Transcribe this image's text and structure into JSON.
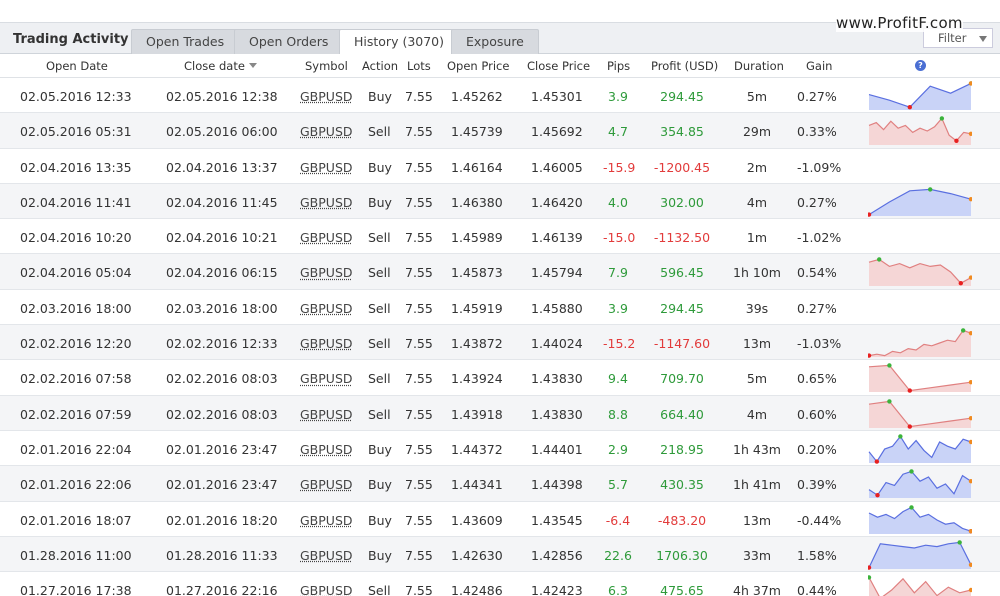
{
  "brand": "www.ProfitF.com",
  "title": "Trading Activity",
  "tabs": [
    {
      "label": "Open Trades",
      "active": false
    },
    {
      "label": "Open Orders",
      "active": false
    },
    {
      "label": "History (3070)",
      "active": true
    },
    {
      "label": "Exposure",
      "active": false
    }
  ],
  "filter": {
    "label": "Filter"
  },
  "columns": [
    "Open Date",
    "Close date",
    "Symbol",
    "Action",
    "Lots",
    "Open Price",
    "Close Price",
    "Pips",
    "Profit (USD)",
    "Duration",
    "Gain"
  ],
  "colors": {
    "positive": "#2e9a3a",
    "negative": "#e23b3b",
    "sparkBuyLine": "#5a6fe0",
    "sparkBuyFill": "#c9d3f7",
    "sparkSellLine": "#e08080",
    "sparkSellFill": "#f5d6d6"
  },
  "rows": [
    {
      "open": "02.05.2016 12:33",
      "close": "02.05.2016 12:38",
      "symbol": "GBPUSD",
      "action": "Buy",
      "lots": "7.55",
      "openPrice": "1.45262",
      "closePrice": "1.45301",
      "pips": "3.9",
      "profit": "294.45",
      "duration": "5m",
      "gain": "0.27%",
      "spark": [
        0.55,
        0.35,
        0.1,
        0.85,
        0.6,
        0.95
      ]
    },
    {
      "open": "02.05.2016 05:31",
      "close": "02.05.2016 06:00",
      "symbol": "GBPUSD",
      "action": "Sell",
      "lots": "7.55",
      "openPrice": "1.45739",
      "closePrice": "1.45692",
      "pips": "4.7",
      "profit": "354.85",
      "duration": "29m",
      "gain": "0.33%",
      "spark": [
        0.7,
        0.8,
        0.55,
        0.85,
        0.6,
        0.7,
        0.45,
        0.6,
        0.5,
        0.65,
        0.95,
        0.35,
        0.15,
        0.45,
        0.4
      ]
    },
    {
      "open": "02.04.2016 13:35",
      "close": "02.04.2016 13:37",
      "symbol": "GBPUSD",
      "action": "Buy",
      "lots": "7.55",
      "openPrice": "1.46164",
      "closePrice": "1.46005",
      "pips": "-15.9",
      "profit": "-1200.45",
      "duration": "2m",
      "gain": "-1.09%",
      "spark": []
    },
    {
      "open": "02.04.2016 11:41",
      "close": "02.04.2016 11:45",
      "symbol": "GBPUSD",
      "action": "Buy",
      "lots": "7.55",
      "openPrice": "1.46380",
      "closePrice": "1.46420",
      "pips": "4.0",
      "profit": "302.00",
      "duration": "4m",
      "gain": "0.27%",
      "spark": [
        0.05,
        0.5,
        0.9,
        0.95,
        0.8,
        0.6
      ]
    },
    {
      "open": "02.04.2016 10:20",
      "close": "02.04.2016 10:21",
      "symbol": "GBPUSD",
      "action": "Sell",
      "lots": "7.55",
      "openPrice": "1.45989",
      "closePrice": "1.46139",
      "pips": "-15.0",
      "profit": "-1132.50",
      "duration": "1m",
      "gain": "-1.02%",
      "spark": []
    },
    {
      "open": "02.04.2016 05:04",
      "close": "02.04.2016 06:15",
      "symbol": "GBPUSD",
      "action": "Sell",
      "lots": "7.55",
      "openPrice": "1.45873",
      "closePrice": "1.45794",
      "pips": "7.9",
      "profit": "596.45",
      "duration": "1h 10m",
      "gain": "0.54%",
      "spark": [
        0.85,
        0.95,
        0.7,
        0.8,
        0.65,
        0.8,
        0.7,
        0.75,
        0.5,
        0.1,
        0.3
      ]
    },
    {
      "open": "02.03.2016 18:00",
      "close": "02.03.2016 18:00",
      "symbol": "GBPUSD",
      "action": "Sell",
      "lots": "7.55",
      "openPrice": "1.45919",
      "closePrice": "1.45880",
      "pips": "3.9",
      "profit": "294.45",
      "duration": "39s",
      "gain": "0.27%",
      "spark": []
    },
    {
      "open": "02.02.2016 12:20",
      "close": "02.02.2016 12:33",
      "symbol": "GBPUSD",
      "action": "Sell",
      "lots": "7.55",
      "openPrice": "1.43872",
      "closePrice": "1.44024",
      "pips": "-15.2",
      "profit": "-1147.60",
      "duration": "13m",
      "gain": "-1.03%",
      "spark": [
        0.05,
        0.1,
        0.05,
        0.2,
        0.15,
        0.3,
        0.25,
        0.45,
        0.4,
        0.5,
        0.6,
        0.55,
        0.95,
        0.85
      ]
    },
    {
      "open": "02.02.2016 07:58",
      "close": "02.02.2016 08:03",
      "symbol": "GBPUSD",
      "action": "Sell",
      "lots": "7.55",
      "openPrice": "1.43924",
      "closePrice": "1.43830",
      "pips": "9.4",
      "profit": "709.70",
      "duration": "5m",
      "gain": "0.65%",
      "spark": [
        0.9,
        0.95,
        0.05,
        0.15,
        0.25,
        0.35
      ]
    },
    {
      "open": "02.02.2016 07:59",
      "close": "02.02.2016 08:03",
      "symbol": "GBPUSD",
      "action": "Sell",
      "lots": "7.55",
      "openPrice": "1.43918",
      "closePrice": "1.43830",
      "pips": "8.8",
      "profit": "664.40",
      "duration": "4m",
      "gain": "0.60%",
      "spark": [
        0.85,
        0.95,
        0.05,
        0.15,
        0.25,
        0.35
      ]
    },
    {
      "open": "02.01.2016 22:04",
      "close": "02.01.2016 23:47",
      "symbol": "GBPUSD",
      "action": "Buy",
      "lots": "7.55",
      "openPrice": "1.44372",
      "closePrice": "1.44401",
      "pips": "2.9",
      "profit": "218.95",
      "duration": "1h 43m",
      "gain": "0.20%",
      "spark": [
        0.4,
        0.05,
        0.5,
        0.6,
        0.95,
        0.5,
        0.8,
        0.45,
        0.2,
        0.75,
        0.6,
        0.5,
        0.85,
        0.75
      ]
    },
    {
      "open": "02.01.2016 22:06",
      "close": "02.01.2016 23:47",
      "symbol": "GBPUSD",
      "action": "Buy",
      "lots": "7.55",
      "openPrice": "1.44341",
      "closePrice": "1.44398",
      "pips": "5.7",
      "profit": "430.35",
      "duration": "1h 41m",
      "gain": "0.39%",
      "spark": [
        0.3,
        0.1,
        0.55,
        0.45,
        0.85,
        0.95,
        0.6,
        0.75,
        0.35,
        0.5,
        0.15,
        0.8,
        0.6
      ]
    },
    {
      "open": "02.01.2016 18:07",
      "close": "02.01.2016 18:20",
      "symbol": "GBPUSD",
      "action": "Buy",
      "lots": "7.55",
      "openPrice": "1.43609",
      "closePrice": "1.43545",
      "pips": "-6.4",
      "profit": "-483.20",
      "duration": "13m",
      "gain": "-0.44%",
      "spark": [
        0.75,
        0.6,
        0.7,
        0.55,
        0.8,
        0.95,
        0.6,
        0.7,
        0.5,
        0.35,
        0.4,
        0.2,
        0.1
      ]
    },
    {
      "open": "01.28.2016 11:00",
      "close": "01.28.2016 11:33",
      "symbol": "GBPUSD",
      "action": "Buy",
      "lots": "7.55",
      "openPrice": "1.42630",
      "closePrice": "1.42856",
      "pips": "22.6",
      "profit": "1706.30",
      "duration": "33m",
      "gain": "1.58%",
      "spark": [
        0.05,
        0.9,
        0.85,
        0.8,
        0.75,
        0.85,
        0.8,
        0.9,
        0.95,
        0.15
      ]
    },
    {
      "open": "01.27.2016 17:38",
      "close": "01.27.2016 22:16",
      "symbol": "GBPUSD",
      "action": "Sell",
      "lots": "7.55",
      "openPrice": "1.42486",
      "closePrice": "1.42423",
      "pips": "6.3",
      "profit": "475.65",
      "duration": "4h 37m",
      "gain": "0.44%",
      "spark": [
        0.95,
        0.2,
        0.5,
        0.9,
        0.4,
        0.8,
        0.3,
        0.6,
        0.4,
        0.5
      ]
    }
  ]
}
